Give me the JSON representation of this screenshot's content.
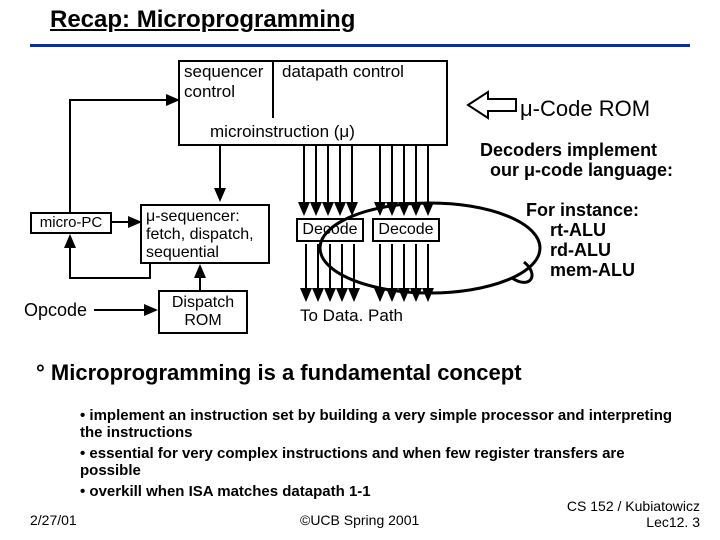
{
  "title": "Recap: Microprogramming",
  "diagram": {
    "seq_label": "sequencer control",
    "dp_label": "datapath control",
    "code_rom": "μ-Code ROM",
    "microinstr": "microinstruction (μ)",
    "decoders_line1": "Decoders implement",
    "decoders_line2": "our μ-code language:",
    "micro_pc": "micro-PC",
    "useq_line1": "μ-sequencer:",
    "useq_line2": "fetch, dispatch,",
    "useq_line3": "sequential",
    "decode": "Decode",
    "for_instance": "For instance:",
    "fi1": "rt-ALU",
    "fi2": "rd-ALU",
    "fi3": "mem-ALU",
    "opcode": "Opcode",
    "dispatch_line1": "Dispatch",
    "dispatch_line2": "ROM",
    "to_dp": "To Data. Path"
  },
  "concept_heading": "° Microprogramming is a fundamental concept",
  "bullets": [
    "implement an instruction set by building a very simple processor and interpreting the instructions",
    "essential for very complex instructions and when few register transfers are possible",
    "overkill when ISA matches datapath 1-1"
  ],
  "footer": {
    "date": "2/27/01",
    "center": "©UCB Spring 2001",
    "right1": "CS 152 / Kubiatowicz",
    "right2": "Lec12. 3"
  }
}
